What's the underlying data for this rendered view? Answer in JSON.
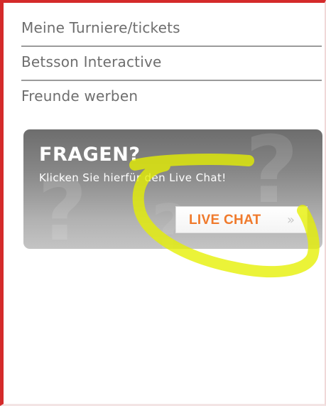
{
  "menu": {
    "items": [
      {
        "label": "Meine Turniere/tickets"
      },
      {
        "label": "Betsson Interactive"
      },
      {
        "label": "Freunde werben"
      }
    ]
  },
  "promo": {
    "title": "FRAGEN?",
    "subtitle": "Klicken Sie hierfür den Live Chat!",
    "button_label": "LIVE CHAT",
    "button_arrow": "»",
    "background_icon": "question-mark-icon"
  },
  "colors": {
    "frame_border": "#d42a2a",
    "menu_text": "#6e6e6e",
    "button_text": "#f07a2c",
    "highlight_marker": "#e6f000"
  }
}
